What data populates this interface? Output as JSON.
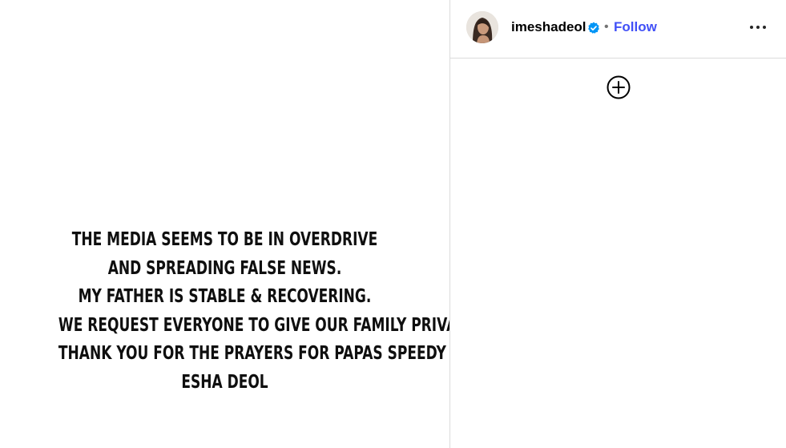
{
  "post": {
    "statement_lines": [
      "THE MEDIA SEEMS TO BE IN OVERDRIVE",
      "AND SPREADING FALSE NEWS.",
      "MY FATHER IS STABLE & RECOVERING.",
      "WE REQUEST EVERYONE TO GIVE OUR FAMILY PRIVACY.",
      "THANK YOU FOR THE PRAYERS FOR PAPAS SPEEDY RECOVERY.",
      "ESHA DEOL"
    ]
  },
  "header": {
    "username": "imeshadeol",
    "separator": "•",
    "follow_label": "Follow",
    "verified_icon": "verified-badge-icon",
    "more_icon": "more-options-icon"
  },
  "sidebar": {
    "add_icon": "add-circle-icon"
  },
  "colors": {
    "follow": "#4150f7",
    "verified": "#0095f6",
    "divider": "#dbdbdb",
    "text": "#000000"
  }
}
